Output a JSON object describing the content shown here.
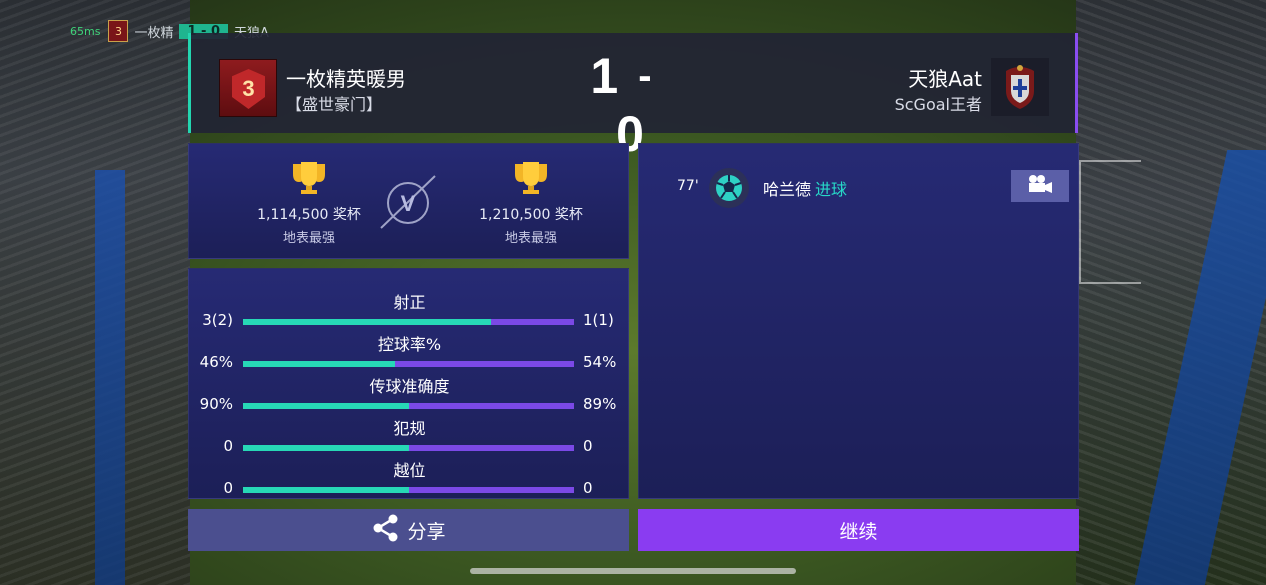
{
  "mini_hud": {
    "ping": "65ms",
    "rank": "3",
    "home": "一枚精",
    "score": "1 - 0",
    "away": "天狼A"
  },
  "header": {
    "home_rank": "3",
    "home_name": "一枚精英暖男",
    "home_club": "【盛世豪门】",
    "score_home": "1",
    "score_sep": "-",
    "score_away": "0",
    "away_name": "天狼Aat",
    "away_club": "ScGoal王者"
  },
  "trophies": {
    "home_value": "1,114,500 奖杯",
    "home_label": "地表最强",
    "vs_label": "V",
    "away_value": "1,210,500 奖杯",
    "away_label": "地表最强"
  },
  "stats": [
    {
      "title": "射正",
      "home": "3(2)",
      "away": "1(1)",
      "home_share": 0.75
    },
    {
      "title": "控球率%",
      "home": "46%",
      "away": "54%",
      "home_share": 0.46
    },
    {
      "title": "传球准确度",
      "home": "90%",
      "away": "89%",
      "home_share": 0.5
    },
    {
      "title": "犯规",
      "home": "0",
      "away": "0",
      "home_share": 0.5
    },
    {
      "title": "越位",
      "home": "0",
      "away": "0",
      "home_share": 0.5
    }
  ],
  "events": [
    {
      "minute": "77'",
      "player": "哈兰德",
      "type": "进球"
    }
  ],
  "buttons": {
    "share": "分享",
    "continue": "继续"
  },
  "colors": {
    "home_accent": "#27d8b6",
    "away_accent": "#7b49e6",
    "continue_bg": "#8a3cf1",
    "goal_text": "#27d8c8"
  },
  "icons": {
    "trophy": "trophy-icon",
    "football": "football-icon",
    "video": "video-camera-icon",
    "share": "share-icon",
    "crest": "portugal-crest-icon"
  }
}
